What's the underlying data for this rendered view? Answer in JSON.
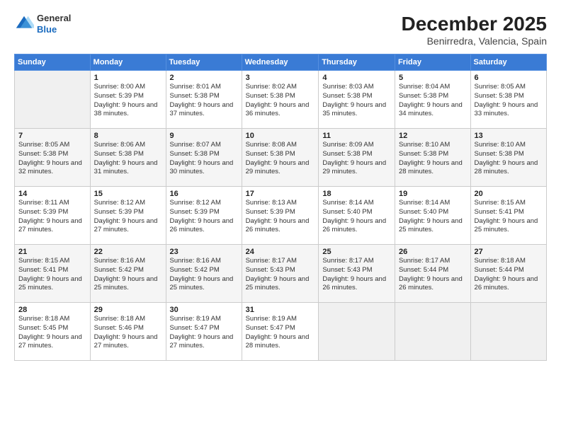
{
  "header": {
    "logo": {
      "general": "General",
      "blue": "Blue"
    },
    "title": "December 2025",
    "subtitle": "Benirredra, Valencia, Spain"
  },
  "columns": [
    "Sunday",
    "Monday",
    "Tuesday",
    "Wednesday",
    "Thursday",
    "Friday",
    "Saturday"
  ],
  "weeks": [
    [
      null,
      {
        "num": "1",
        "sunrise": "8:00 AM",
        "sunset": "5:39 PM",
        "daylight": "9 hours and 38 minutes."
      },
      {
        "num": "2",
        "sunrise": "8:01 AM",
        "sunset": "5:38 PM",
        "daylight": "9 hours and 37 minutes."
      },
      {
        "num": "3",
        "sunrise": "8:02 AM",
        "sunset": "5:38 PM",
        "daylight": "9 hours and 36 minutes."
      },
      {
        "num": "4",
        "sunrise": "8:03 AM",
        "sunset": "5:38 PM",
        "daylight": "9 hours and 35 minutes."
      },
      {
        "num": "5",
        "sunrise": "8:04 AM",
        "sunset": "5:38 PM",
        "daylight": "9 hours and 34 minutes."
      },
      {
        "num": "6",
        "sunrise": "8:05 AM",
        "sunset": "5:38 PM",
        "daylight": "9 hours and 33 minutes."
      }
    ],
    [
      {
        "num": "7",
        "sunrise": "8:05 AM",
        "sunset": "5:38 PM",
        "daylight": "9 hours and 32 minutes."
      },
      {
        "num": "8",
        "sunrise": "8:06 AM",
        "sunset": "5:38 PM",
        "daylight": "9 hours and 31 minutes."
      },
      {
        "num": "9",
        "sunrise": "8:07 AM",
        "sunset": "5:38 PM",
        "daylight": "9 hours and 30 minutes."
      },
      {
        "num": "10",
        "sunrise": "8:08 AM",
        "sunset": "5:38 PM",
        "daylight": "9 hours and 29 minutes."
      },
      {
        "num": "11",
        "sunrise": "8:09 AM",
        "sunset": "5:38 PM",
        "daylight": "9 hours and 29 minutes."
      },
      {
        "num": "12",
        "sunrise": "8:10 AM",
        "sunset": "5:38 PM",
        "daylight": "9 hours and 28 minutes."
      },
      {
        "num": "13",
        "sunrise": "8:10 AM",
        "sunset": "5:38 PM",
        "daylight": "9 hours and 28 minutes."
      }
    ],
    [
      {
        "num": "14",
        "sunrise": "8:11 AM",
        "sunset": "5:39 PM",
        "daylight": "9 hours and 27 minutes."
      },
      {
        "num": "15",
        "sunrise": "8:12 AM",
        "sunset": "5:39 PM",
        "daylight": "9 hours and 27 minutes."
      },
      {
        "num": "16",
        "sunrise": "8:12 AM",
        "sunset": "5:39 PM",
        "daylight": "9 hours and 26 minutes."
      },
      {
        "num": "17",
        "sunrise": "8:13 AM",
        "sunset": "5:39 PM",
        "daylight": "9 hours and 26 minutes."
      },
      {
        "num": "18",
        "sunrise": "8:14 AM",
        "sunset": "5:40 PM",
        "daylight": "9 hours and 26 minutes."
      },
      {
        "num": "19",
        "sunrise": "8:14 AM",
        "sunset": "5:40 PM",
        "daylight": "9 hours and 25 minutes."
      },
      {
        "num": "20",
        "sunrise": "8:15 AM",
        "sunset": "5:41 PM",
        "daylight": "9 hours and 25 minutes."
      }
    ],
    [
      {
        "num": "21",
        "sunrise": "8:15 AM",
        "sunset": "5:41 PM",
        "daylight": "9 hours and 25 minutes."
      },
      {
        "num": "22",
        "sunrise": "8:16 AM",
        "sunset": "5:42 PM",
        "daylight": "9 hours and 25 minutes."
      },
      {
        "num": "23",
        "sunrise": "8:16 AM",
        "sunset": "5:42 PM",
        "daylight": "9 hours and 25 minutes."
      },
      {
        "num": "24",
        "sunrise": "8:17 AM",
        "sunset": "5:43 PM",
        "daylight": "9 hours and 25 minutes."
      },
      {
        "num": "25",
        "sunrise": "8:17 AM",
        "sunset": "5:43 PM",
        "daylight": "9 hours and 26 minutes."
      },
      {
        "num": "26",
        "sunrise": "8:17 AM",
        "sunset": "5:44 PM",
        "daylight": "9 hours and 26 minutes."
      },
      {
        "num": "27",
        "sunrise": "8:18 AM",
        "sunset": "5:44 PM",
        "daylight": "9 hours and 26 minutes."
      }
    ],
    [
      {
        "num": "28",
        "sunrise": "8:18 AM",
        "sunset": "5:45 PM",
        "daylight": "9 hours and 27 minutes."
      },
      {
        "num": "29",
        "sunrise": "8:18 AM",
        "sunset": "5:46 PM",
        "daylight": "9 hours and 27 minutes."
      },
      {
        "num": "30",
        "sunrise": "8:19 AM",
        "sunset": "5:47 PM",
        "daylight": "9 hours and 27 minutes."
      },
      {
        "num": "31",
        "sunrise": "8:19 AM",
        "sunset": "5:47 PM",
        "daylight": "9 hours and 28 minutes."
      },
      null,
      null,
      null
    ]
  ]
}
